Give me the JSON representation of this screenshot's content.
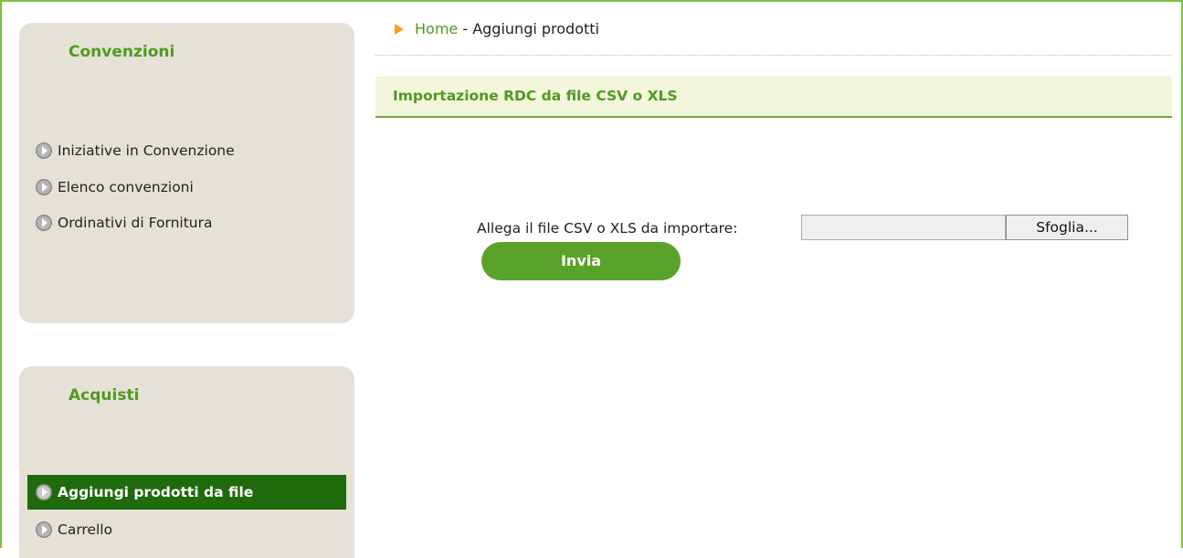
{
  "sidebar": {
    "convenzioni": {
      "title": "Convenzioni",
      "items": [
        {
          "label": "Iniziative in Convenzione"
        },
        {
          "label": "Elenco convenzioni"
        },
        {
          "label": "Ordinativi di Fornitura"
        }
      ]
    },
    "acquisti": {
      "title": "Acquisti",
      "items": [
        {
          "label": "Aggiungi prodotti da file",
          "active": true
        },
        {
          "label": "Carrello"
        }
      ]
    }
  },
  "breadcrumb": {
    "home": "Home",
    "separator": " - ",
    "current": "Aggiungi prodotti"
  },
  "section": {
    "title": "Importazione RDC da file CSV o XLS"
  },
  "form": {
    "file_label": "Allega il file CSV o XLS da importare:",
    "file_value": "",
    "browse_label": "Sfoglia...",
    "submit_label": "Invia"
  },
  "colors": {
    "accent_green": "#4f9a1f",
    "active_item_bg": "#1e6a0c",
    "button_green": "#5aa32a",
    "sidebar_bg": "#e6e1d7",
    "breadcrumb_arrow": "#f3a31b"
  },
  "icons": {
    "menu_bullet": "circle-arrow-right-icon",
    "breadcrumb": "triangle-right-icon"
  }
}
